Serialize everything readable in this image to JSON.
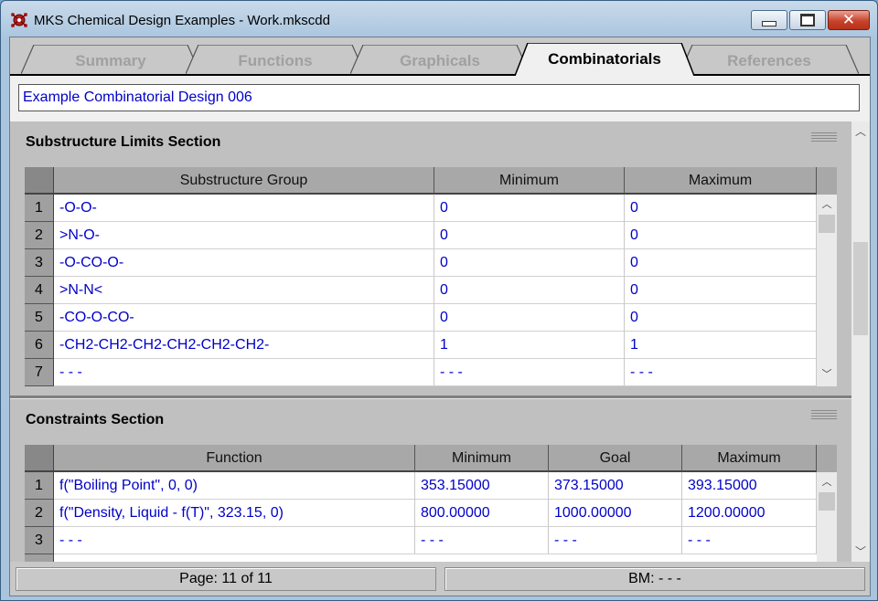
{
  "window": {
    "title": "MKS Chemical Design Examples - Work.mkscdd",
    "close_glyph": "✕"
  },
  "tabs": [
    {
      "label": "Summary",
      "active": false
    },
    {
      "label": "Functions",
      "active": false
    },
    {
      "label": "Graphicals",
      "active": false
    },
    {
      "label": "Combinatorials",
      "active": true
    },
    {
      "label": "References",
      "active": false
    }
  ],
  "design_name": "Example Combinatorial Design 006",
  "substructure_section": {
    "title": "Substructure Limits Section",
    "columns": [
      "Substructure Group",
      "Minimum",
      "Maximum"
    ],
    "rows": [
      {
        "num": "1",
        "cells": [
          "-O-O-",
          "0",
          "0"
        ]
      },
      {
        "num": "2",
        "cells": [
          ">N-O-",
          "0",
          "0"
        ]
      },
      {
        "num": "3",
        "cells": [
          "-O-CO-O-",
          "0",
          "0"
        ]
      },
      {
        "num": "4",
        "cells": [
          ">N-N<",
          "0",
          "0"
        ]
      },
      {
        "num": "5",
        "cells": [
          "-CO-O-CO-",
          "0",
          "0"
        ]
      },
      {
        "num": "6",
        "cells": [
          "-CH2-CH2-CH2-CH2-CH2-CH2-",
          "1",
          "1"
        ]
      },
      {
        "num": "7",
        "cells": [
          "- - -",
          "- - -",
          "- - -"
        ]
      }
    ]
  },
  "constraints_section": {
    "title": "Constraints Section",
    "columns": [
      "Function",
      "Minimum",
      "Goal",
      "Maximum"
    ],
    "rows": [
      {
        "num": "1",
        "cells": [
          "f(\"Boiling Point\", 0, 0)",
          "353.15000",
          "373.15000",
          "393.15000"
        ]
      },
      {
        "num": "2",
        "cells": [
          "f(\"Density, Liquid - f(T)\", 323.15, 0)",
          "800.00000",
          "1000.00000",
          "1200.00000"
        ]
      },
      {
        "num": "3",
        "cells": [
          "- - -",
          "- - -",
          "- - -",
          "- - -"
        ]
      }
    ]
  },
  "scroll_glyphs": {
    "up": "︿",
    "down": "﹀"
  },
  "status": {
    "page": "Page: 11 of 11",
    "bm": "BM: - - -"
  },
  "colors": {
    "value_text": "#0000c8",
    "header_bg": "#a8a8a8"
  }
}
